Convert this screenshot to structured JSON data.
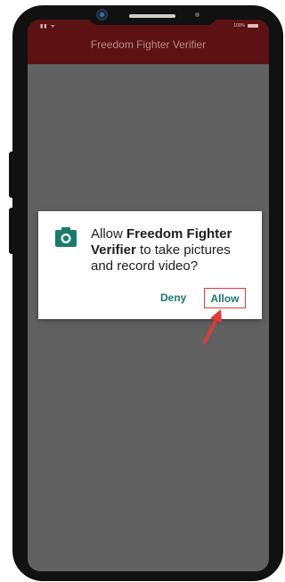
{
  "status_bar": {
    "left_icons": "▮▮ ᯤ",
    "battery_text": "100%"
  },
  "app_bar": {
    "title": "Freedom Fighter Verifier"
  },
  "permission_dialog": {
    "icon": "camera-icon",
    "message_prefix": "Allow ",
    "app_name": "Freedom Fighter Verifier",
    "message_suffix": " to take pictures and record video?",
    "deny_label": "Deny",
    "allow_label": "Allow"
  },
  "annotation": {
    "highlight_color": "#e53935",
    "arrow_target": "allow-button"
  },
  "colors": {
    "app_bar": "#5c1212",
    "scrim": "#616161",
    "accent": "#1c7a6c"
  }
}
